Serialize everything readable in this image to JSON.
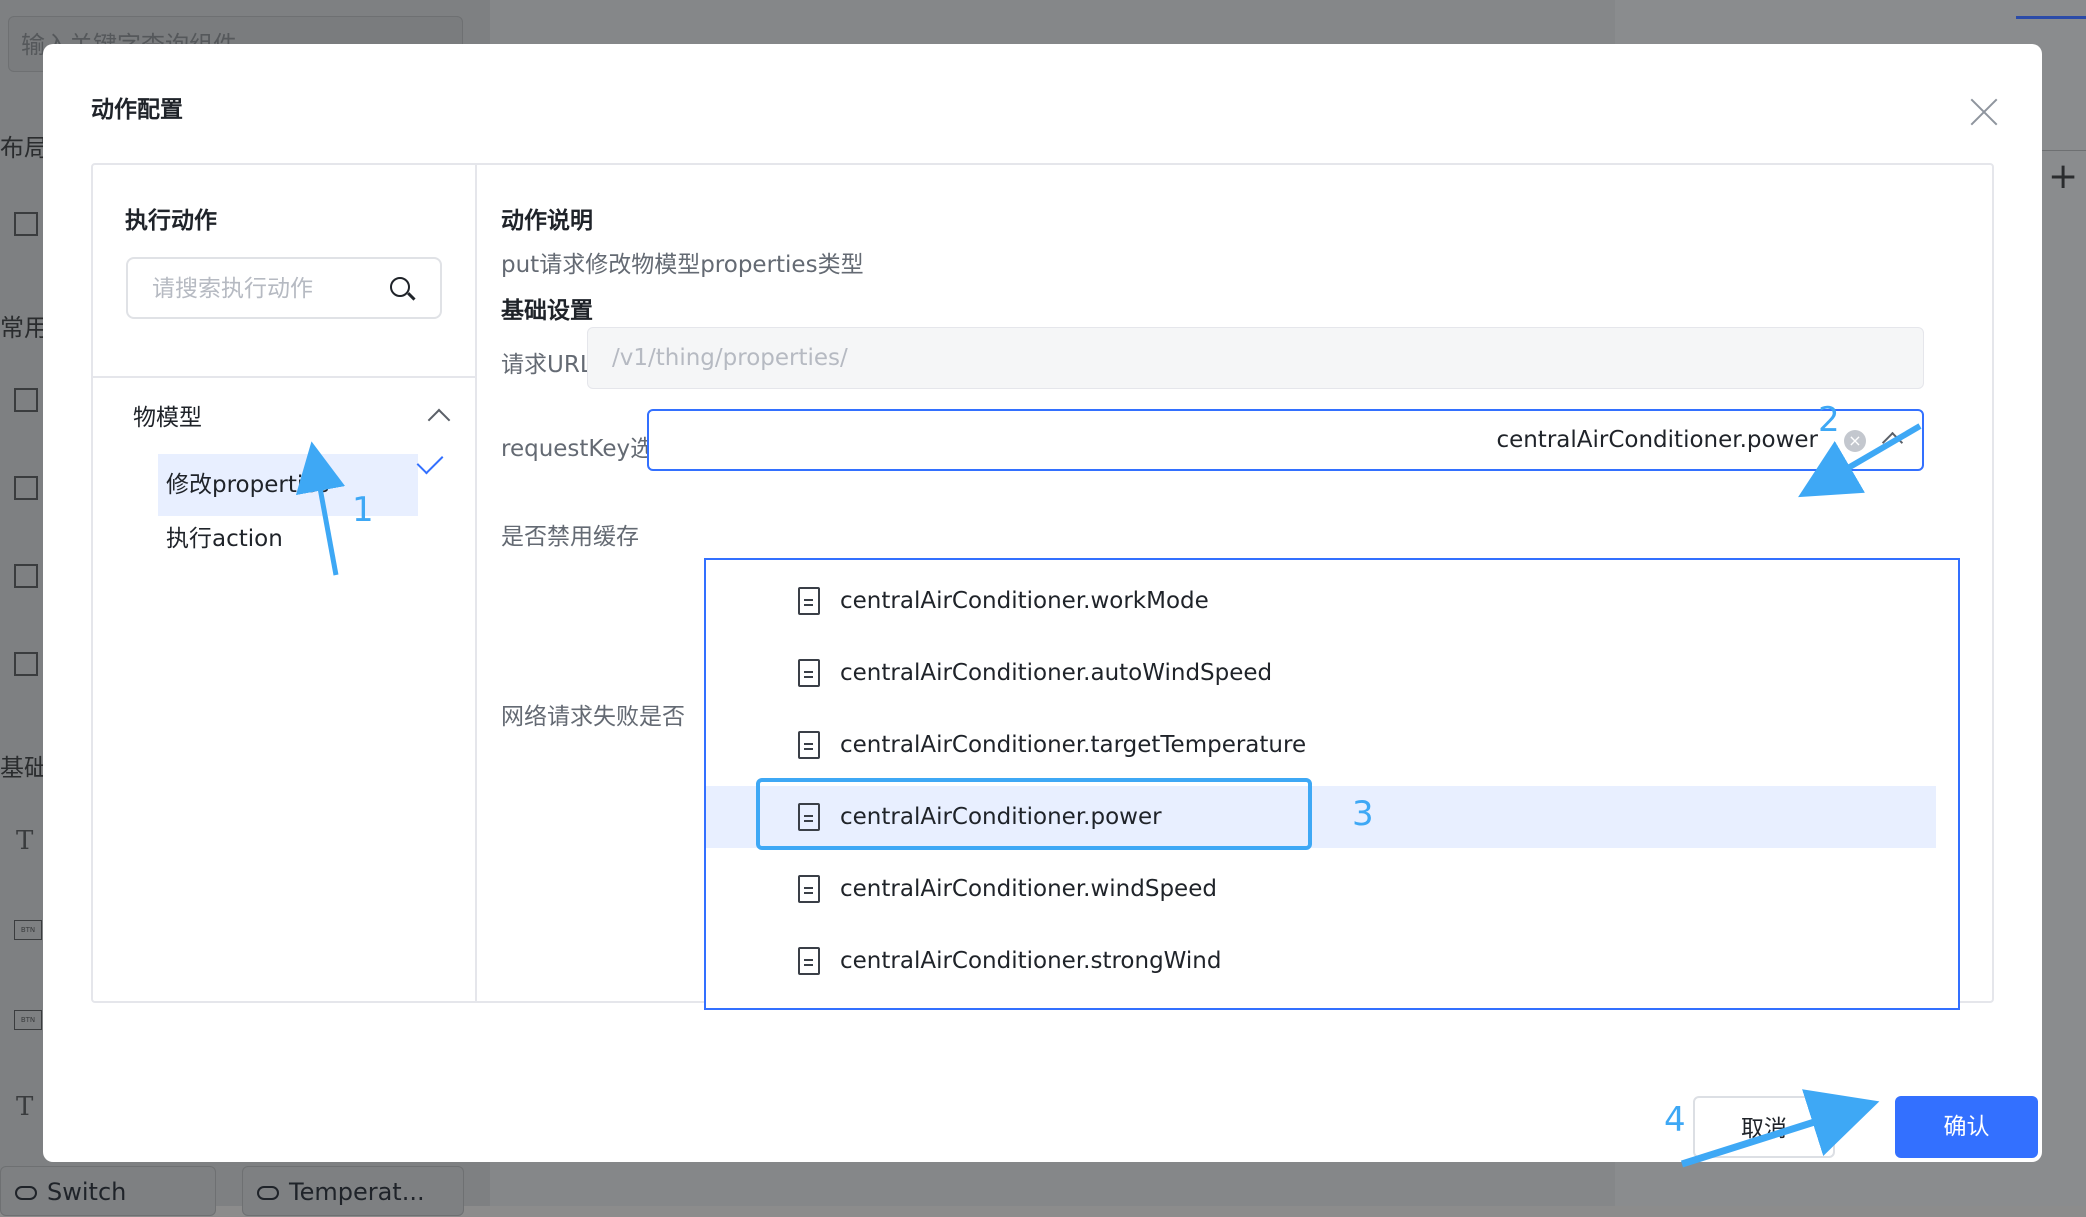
{
  "background": {
    "search_placeholder": "输入关键字查询组件",
    "sections": [
      "布局",
      "常用",
      "基础"
    ],
    "chips": [
      "Switch",
      "Temperat..."
    ]
  },
  "modal": {
    "title": "动作配置",
    "left": {
      "heading": "执行动作",
      "search_placeholder": "请搜索执行动作",
      "group": "物模型",
      "items": [
        "修改properties",
        "执行action"
      ]
    },
    "right": {
      "desc_title": "动作说明",
      "desc_text": "put请求修改物模型properties类型",
      "basic_title": "基础设置",
      "url_label": "请求URL",
      "url_placeholder": "/v1/thing/properties/",
      "request_key_label": "requestKey选择",
      "request_key_value": "centralAirConditioner.power",
      "disable_cache_label": "是否禁用缓存",
      "network_fail_label": "网络请求失败是否"
    },
    "dropdown": {
      "options": [
        "centralAirConditioner.workMode",
        "centralAirConditioner.autoWindSpeed",
        "centralAirConditioner.targetTemperature",
        "centralAirConditioner.power",
        "centralAirConditioner.windSpeed",
        "centralAirConditioner.strongWind"
      ]
    },
    "buttons": {
      "cancel": "取消",
      "confirm": "确认"
    }
  },
  "annotations": {
    "step1": "1",
    "step2": "2",
    "step3": "3",
    "step4": "4",
    "color": "#3ea8f5"
  },
  "colors": {
    "primary": "#3370ff",
    "selected_bg": "#e8efff"
  }
}
